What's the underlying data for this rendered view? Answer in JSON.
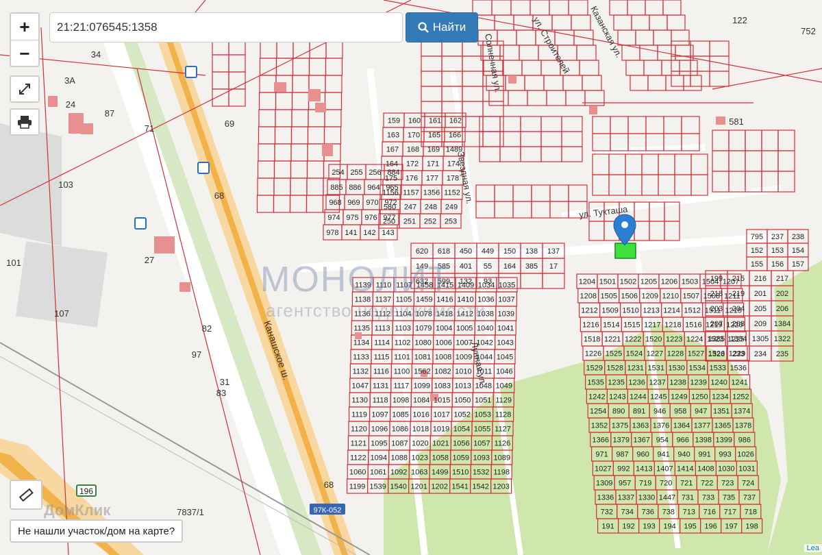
{
  "search": {
    "value": "21:21:076545:1358",
    "button_label": "Найти"
  },
  "controls": {
    "zoom_in": "+",
    "zoom_out": "−"
  },
  "not_found_label": "Не нашли участок/дом на карте?",
  "attribution": "Lea",
  "watermark": {
    "title": "МОНОЛИТ",
    "subtitle": "агентство недвижимости"
  },
  "domclick_watermark": "ДомКлик",
  "colors": {
    "boundary": "#d0303a",
    "road": "#f1b24a",
    "green": "#c9e3a4",
    "button": "#337ab7",
    "selected_parcel": "#3ee03e",
    "marker": "#2a7fd0"
  },
  "streets": {
    "kanashskoe": "Канашское ш.",
    "tuktasha": "ул. Тукташа",
    "stroiteley": "ул. Строителей",
    "solnechnaya": "Солнечная ул.",
    "zvezdnaya": "Звездная ул.",
    "lunnaya": "Лунная ул.",
    "kazanskaya": "Казанская ул."
  },
  "road_badges": {
    "r196": "196",
    "r97k": "97К-052"
  },
  "big_labels": {
    "b122": "122",
    "b752": "752",
    "b581": "581",
    "b103": "103",
    "b101": "101",
    "b107": "107",
    "b27": "27",
    "b24": "24",
    "b87": "87",
    "b68": "68",
    "b69": "69",
    "b71": "71",
    "b7837": "7837/1",
    "b68b": "68",
    "b31": "31",
    "b83": "83",
    "b97": "97",
    "b82": "82",
    "b34": "34",
    "b3a": "3А"
  },
  "parcel_numbers": [
    "1139",
    "1110",
    "1107",
    "1458",
    "1415",
    "1409",
    "1034",
    "1035",
    "1138",
    "1137",
    "1105",
    "1459",
    "1416",
    "1410",
    "1036",
    "1037",
    "1136",
    "1112",
    "1104",
    "1078",
    "1418",
    "1412",
    "1038",
    "1039",
    "1135",
    "1113",
    "1103",
    "1079",
    "1004",
    "1005",
    "1040",
    "1041",
    "1134",
    "1114",
    "1102",
    "1080",
    "1006",
    "1007",
    "1042",
    "1043",
    "1133",
    "1115",
    "1101",
    "1081",
    "1008",
    "1009",
    "1044",
    "1045",
    "1132",
    "1116",
    "1100",
    "1562",
    "1082",
    "1010",
    "1011",
    "1046",
    "1047",
    "1131",
    "1117",
    "1099",
    "1083",
    "1013",
    "1048",
    "1049",
    "1130",
    "1118",
    "1098",
    "1084",
    "1015",
    "1050",
    "1051",
    "1129",
    "1119",
    "1097",
    "1085",
    "1016",
    "1017",
    "1052",
    "1053",
    "1128",
    "1120",
    "1096",
    "1086",
    "1018",
    "1019",
    "1054",
    "1055",
    "1127",
    "1121",
    "1095",
    "1087",
    "1020",
    "1021",
    "1056",
    "1057",
    "1126",
    "1122",
    "1094",
    "1088",
    "1023",
    "1058",
    "1059",
    "1093",
    "1089",
    "1060",
    "1061",
    "1092",
    "1063",
    "1499",
    "1510",
    "1532",
    "1198",
    "1199",
    "1539",
    "1540",
    "1201",
    "1202",
    "1541",
    "1542",
    "1203",
    "1204",
    "1501",
    "1502",
    "1205",
    "1206",
    "1503",
    "1504",
    "1207",
    "1208",
    "1505",
    "1506",
    "1209",
    "1210",
    "1507",
    "1508",
    "1211",
    "1212",
    "1509",
    "1510",
    "1213",
    "1214",
    "1512",
    "1511",
    "1215",
    "1216",
    "1514",
    "1515",
    "1217",
    "1218",
    "1516",
    "1219",
    "1220",
    "1518",
    "1221",
    "1222",
    "1520",
    "1223",
    "1224",
    "1523",
    "1225",
    "1226",
    "1525",
    "1524",
    "1227",
    "1228",
    "1527",
    "1526",
    "1229",
    "1529",
    "1528",
    "1231",
    "1531",
    "1530",
    "1534",
    "1533",
    "1536",
    "1535",
    "1235",
    "1236",
    "1237",
    "1238",
    "1239",
    "1240",
    "1241",
    "1242",
    "1243",
    "1244",
    "1245",
    "1249",
    "1250",
    "1234",
    "1252",
    "1254",
    "890",
    "891",
    "946",
    "958",
    "947",
    "1351",
    "1374",
    "1352",
    "1375",
    "1363",
    "1376",
    "1364",
    "1377",
    "1365",
    "1378",
    "1366",
    "1379",
    "1367",
    "954",
    "966",
    "1398",
    "1399",
    "986",
    "971",
    "987",
    "960",
    "941",
    "940",
    "991",
    "993",
    "1026",
    "1027",
    "992",
    "1413",
    "1407",
    "1414",
    "1408",
    "1030",
    "1031",
    "1309",
    "957",
    "719",
    "720",
    "721",
    "722",
    "723",
    "724",
    "1336",
    "1337",
    "1330",
    "1447",
    "731",
    "733",
    "735",
    "737",
    "732",
    "734",
    "736",
    "738",
    "713",
    "716",
    "717",
    "718",
    "191",
    "192",
    "193",
    "194",
    "195",
    "196",
    "197",
    "198",
    "199",
    "215",
    "216",
    "217",
    "218",
    "219",
    "201",
    "202",
    "203",
    "204",
    "205",
    "206",
    "207",
    "208",
    "209",
    "1384",
    "1385",
    "1304",
    "1305",
    "1322",
    "1323",
    "233",
    "234",
    "235",
    "795",
    "237",
    "238",
    "152",
    "153",
    "154",
    "155",
    "156",
    "157",
    "159",
    "160",
    "161",
    "162",
    "163",
    "170",
    "165",
    "166",
    "167",
    "168",
    "169",
    "1489",
    "164",
    "172",
    "171",
    "174",
    "175",
    "176",
    "177",
    "178",
    "1156",
    "1157",
    "1356",
    "1152",
    "580",
    "247",
    "248",
    "249",
    "250",
    "251",
    "252",
    "253",
    "254",
    "255",
    "256",
    "884",
    "885",
    "886",
    "964",
    "965",
    "968",
    "969",
    "970",
    "972",
    "974",
    "975",
    "976",
    "977",
    "978",
    "141",
    "142",
    "143",
    "620",
    "618",
    "450",
    "449",
    "150",
    "138",
    "137",
    "149",
    "585",
    "401",
    "55",
    "164",
    "385",
    "17",
    "632",
    "599",
    "132",
    "93"
  ]
}
